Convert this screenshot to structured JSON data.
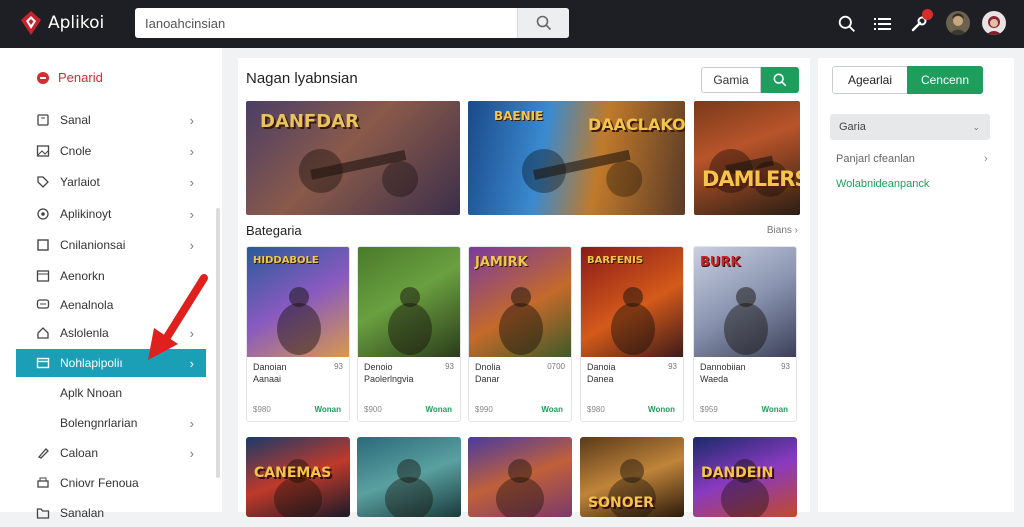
{
  "app": {
    "name": "Aplikoi"
  },
  "search": {
    "value": "Ianoahcinsian"
  },
  "sidebar": {
    "title": "Penarid",
    "items": [
      {
        "label": "Sanal",
        "icon": "box-icon",
        "chev": "›"
      },
      {
        "label": "Cnole",
        "icon": "image-icon",
        "chev": "›"
      },
      {
        "label": "Yarlaiot",
        "icon": "tag-icon",
        "chev": "›"
      },
      {
        "label": "Aplikinoyt",
        "icon": "target-icon",
        "chev": "›"
      },
      {
        "label": "Cnilanionsai",
        "icon": "square-icon",
        "chev": "›"
      },
      {
        "label": "Aenorkn",
        "icon": "window-icon",
        "chev": ""
      },
      {
        "label": "Aenalnola",
        "icon": "chat-icon",
        "chev": ""
      },
      {
        "label": "Aslolenla",
        "icon": "house-icon",
        "chev": "›"
      },
      {
        "label": "Nohlapipoliı",
        "icon": "card-icon",
        "chev": "›"
      },
      {
        "label": "Aplk Nnoan",
        "icon": "",
        "chev": ""
      },
      {
        "label": "Bolengnrlarian",
        "icon": "",
        "chev": "›"
      },
      {
        "label": "Caloan",
        "icon": "pen-icon",
        "chev": "›"
      },
      {
        "label": "Cniovr Fenoua",
        "icon": "printer-icon",
        "chev": ""
      },
      {
        "label": "Sanalan",
        "icon": "folder-icon",
        "chev": ""
      }
    ]
  },
  "main": {
    "title": "Nagan lyabnsian",
    "seg_label": "Gamia",
    "banners": [
      "DANFDAR",
      "BAENIE",
      "DAACLAKON",
      "DAMLERS"
    ],
    "category": {
      "title": "Bategaria",
      "more": "Bians ›"
    },
    "cards": [
      {
        "art": "HIDDABOLE",
        "l1": "Danoian",
        "l2": "Aanaai",
        "badge": "93",
        "price": "$980",
        "act": "Wonan"
      },
      {
        "art": "",
        "l1": "Denoio",
        "l2": "Paolerlngvia",
        "badge": "93",
        "price": "$900",
        "act": "Wonan"
      },
      {
        "art": "JAMIRK",
        "l1": "Dnolia",
        "l2": "Danar",
        "badge": "0700",
        "price": "$990",
        "act": "Woan"
      },
      {
        "art": "BARFENIS",
        "l1": "Danoia",
        "l2": "Danea",
        "badge": "93",
        "price": "$980",
        "act": "Wonon"
      },
      {
        "art": "BURK",
        "l1": "Dannobiian",
        "l2": "Waeda",
        "badge": "93",
        "price": "$959",
        "act": "Wonan"
      }
    ],
    "cards_row2": [
      "CANEMAS",
      "",
      "",
      "SONOER",
      "DANDEIN"
    ]
  },
  "right": {
    "btn1": "Agearlai",
    "btn2": "Cencenn",
    "select": "Garia",
    "select_arrow": "⌄",
    "link1": "Panjarl cfeanlan",
    "link2": "Wolabnideanpanck"
  },
  "colors": {
    "accent_green": "#1e9e5c",
    "active_teal": "#1a9fb7",
    "brand_red": "#d42c33",
    "arrow_red": "#e0201c"
  }
}
